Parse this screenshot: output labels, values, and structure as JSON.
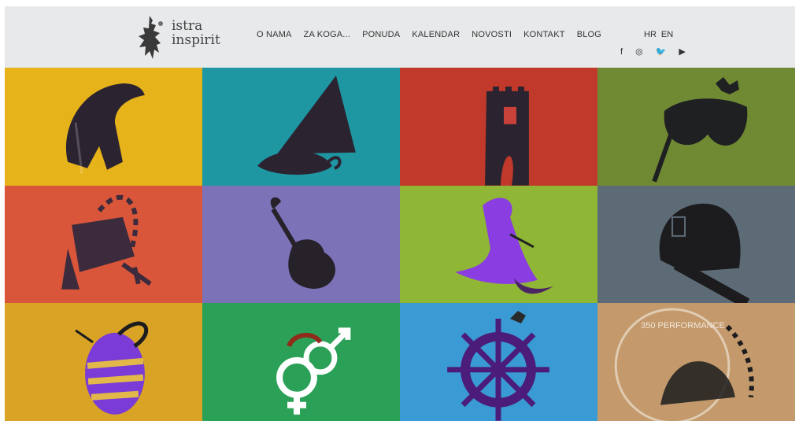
{
  "header": {
    "logo": {
      "line1": "istra",
      "line2": "inspirit"
    },
    "nav": [
      "O NAMA",
      "ZA KOGA...",
      "PONUDA",
      "KALENDAR",
      "NOVOSTI",
      "KONTAKT",
      "BLOG"
    ],
    "languages": [
      "HR",
      "EN"
    ],
    "social": [
      {
        "name": "facebook-icon",
        "glyph": "f"
      },
      {
        "name": "instagram-icon",
        "glyph": "◎"
      },
      {
        "name": "twitter-icon",
        "glyph": "🐦"
      },
      {
        "name": "youtube-icon",
        "glyph": "▶"
      }
    ]
  },
  "tiles": [
    {
      "name": "tile-helmet",
      "color": "#e6b31b",
      "icon": "helmet-icon"
    },
    {
      "name": "tile-boat",
      "color": "#1e97a3",
      "icon": "boat-icon"
    },
    {
      "name": "tile-tower",
      "color": "#c0392b",
      "icon": "tower-icon"
    },
    {
      "name": "tile-mask",
      "color": "#708a33",
      "icon": "mask-icon"
    },
    {
      "name": "tile-treasure",
      "color": "#d9563a",
      "icon": "treasure-chest-icon"
    },
    {
      "name": "tile-violin",
      "color": "#7c72b8",
      "icon": "violin-icon"
    },
    {
      "name": "tile-witch-hat",
      "color": "#8fb635",
      "icon": "witch-hat-icon"
    },
    {
      "name": "tile-lantern",
      "color": "#5d6b77",
      "icon": "lantern-icon"
    },
    {
      "name": "tile-bee",
      "color": "#d9a325",
      "icon": "bee-icon"
    },
    {
      "name": "tile-symbols",
      "color": "#2aa157",
      "icon": "gender-symbols-icon"
    },
    {
      "name": "tile-helm-wheel",
      "color": "#3a9ad3",
      "icon": "ship-wheel-icon"
    },
    {
      "name": "tile-performance",
      "color": "#c49a6c",
      "icon": "performance-badge-icon",
      "badge": "350 PERFORMANCE"
    }
  ]
}
